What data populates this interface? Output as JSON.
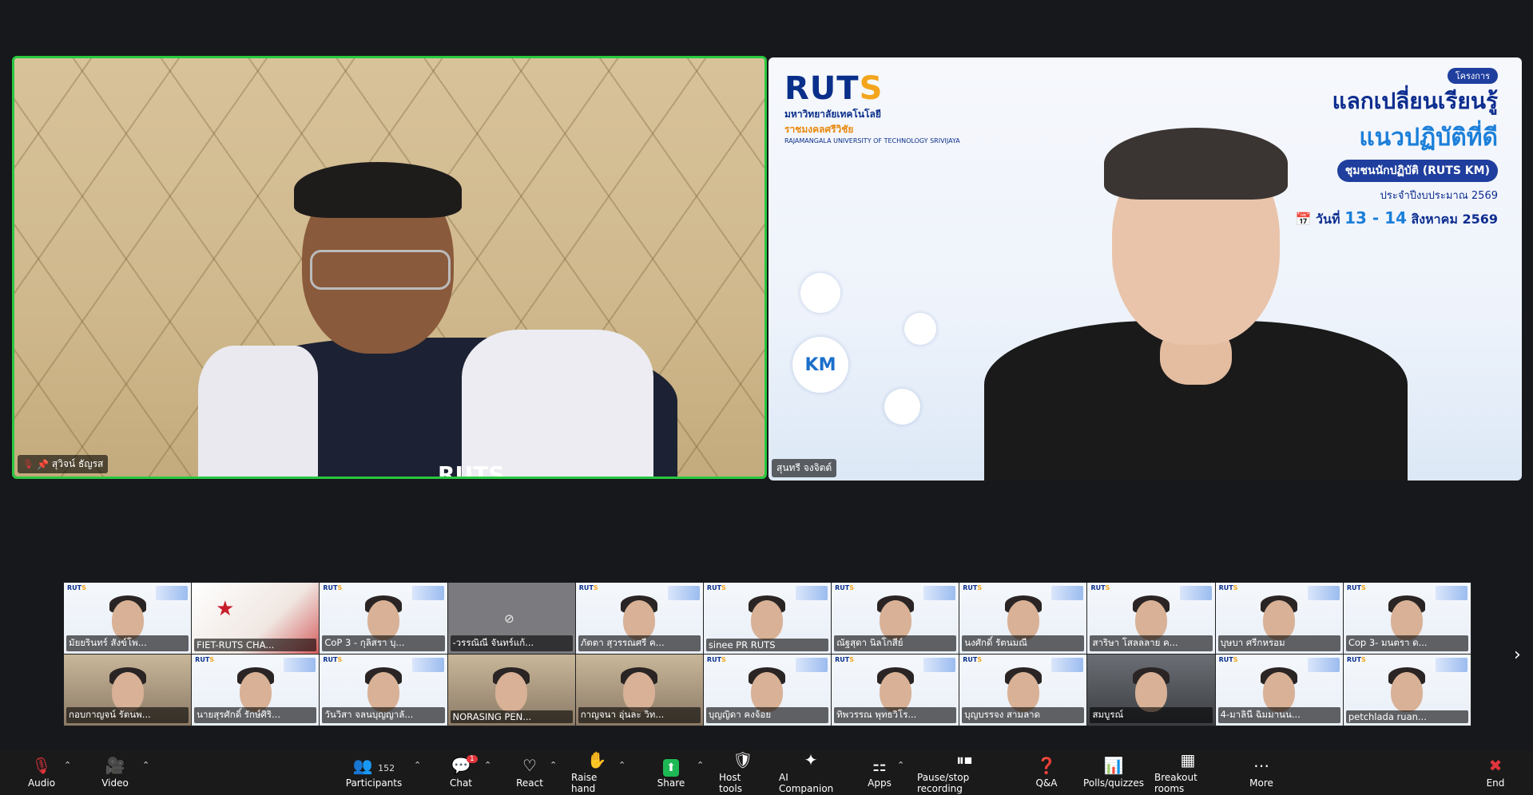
{
  "main_videos": [
    {
      "name": "สุวิจน์ ธัญรส",
      "muted": true,
      "pinned": true
    },
    {
      "name": "สุนทรี จงจิตต์",
      "muted": false
    }
  ],
  "slide": {
    "logo": "RUTS",
    "university_th": "มหาวิทยาลัยเทคโนโลยี",
    "university_th2": "ราชมงคลศรีวิชัย",
    "university_en": "RAJAMANGALA UNIVERSITY OF TECHNOLOGY SRIVIJAYA",
    "tag": "โครงการ",
    "line1": "แลกเปลี่ยนเรียนรู้",
    "line2": "แนวปฏิบัติที่ดี",
    "line3": "ชุมชนนักปฏิบัติ (RUTS KM)",
    "line4": "ประจำปีงบประมาณ 2569",
    "date_prefix": "วันที่",
    "date_main": "13 - 14",
    "date_suffix": "สิงหาคม 2569",
    "km": "KM"
  },
  "participants_strip": [
    {
      "name": "มัยยรินทร์ สังข์โพ...",
      "type": "slide"
    },
    {
      "name": "FIET-RUTS CHA...",
      "type": "poster"
    },
    {
      "name": "CoP 3 - กุลิสรา บุ...",
      "type": "slide"
    },
    {
      "name": "-วรรณิณี จันทร์แก้...",
      "type": "camoff"
    },
    {
      "name": "ภัตตา สุวรรณศรี ค...",
      "type": "slide"
    },
    {
      "name": "sinee PR RUTS",
      "type": "slide"
    },
    {
      "name": "ณัฐสุดา นิลโกสีย์",
      "type": "slide"
    },
    {
      "name": "นงศักดิ์ รัตนมณี",
      "type": "slide"
    },
    {
      "name": "สาริษา โสลลลาย ค...",
      "type": "slide"
    },
    {
      "name": "บุษบา ศรีกหรอม",
      "type": "slide"
    },
    {
      "name": "Cop 3- มนตรา ด...",
      "type": "slide"
    },
    {
      "name": "กอบกาญจน์ รัตนพ...",
      "type": "room"
    },
    {
      "name": "นายสุรศักดิ์ รักษ์ศิริ...",
      "type": "slide"
    },
    {
      "name": "วันวิสา จลนบุญญาลั...",
      "type": "slide"
    },
    {
      "name": "NORASING PEN...",
      "type": "room"
    },
    {
      "name": "กาญจนา อุ่นละ วิท...",
      "type": "room"
    },
    {
      "name": "บุญญิดา คงจ้อย",
      "type": "slide"
    },
    {
      "name": "ทิพวรรณ พุทธวิโร...",
      "type": "slide"
    },
    {
      "name": "บุญบรรจง สามลาด",
      "type": "slide"
    },
    {
      "name": "สมบูรณ์",
      "type": "car"
    },
    {
      "name": "4-มาลินี ฉิมมานน...",
      "type": "slide"
    },
    {
      "name": "petchlada ruan...",
      "type": "slide"
    }
  ],
  "toolbar": {
    "audio": "Audio",
    "video": "Video",
    "participants": "Participants",
    "participants_count": "152",
    "chat": "Chat",
    "chat_badge": "1",
    "react": "React",
    "raise_hand": "Raise hand",
    "share": "Share",
    "host_tools": "Host tools",
    "ai_companion": "AI Companion",
    "apps": "Apps",
    "recording": "Pause/stop recording",
    "qa": "Q&A",
    "polls": "Polls/quizzes",
    "breakout": "Breakout rooms",
    "more": "More",
    "end": "End"
  },
  "colors": {
    "active_speaker_border": "#28c840",
    "end_red": "#e0353b",
    "share_green": "#1db954"
  }
}
